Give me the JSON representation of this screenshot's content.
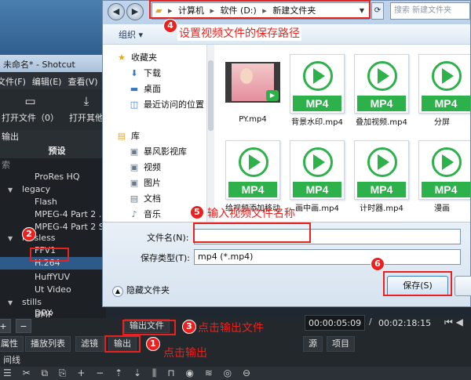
{
  "shotcut": {
    "title": "未命名* - Shotcut",
    "menu": [
      "文件(F)",
      "编辑(E)",
      "查看(V)"
    ],
    "toolbar": {
      "open_file": "打开文件（0）",
      "open_other": "打开其他"
    },
    "panel": {
      "output_tab": "输出",
      "presets_header": "预设",
      "search_hint": "索",
      "tree": [
        {
          "label": "ProRes HQ",
          "level": 2
        },
        {
          "label": "legacy",
          "level": 1,
          "expanded": true
        },
        {
          "label": "Flash",
          "level": 2
        },
        {
          "label": "MPEG-4 Part 2 ...",
          "level": 2
        },
        {
          "label": "MPEG-4 Part 2 S",
          "level": 2
        },
        {
          "label": "lossless",
          "level": 1,
          "expanded": true
        },
        {
          "label": "FFV1",
          "level": 2
        },
        {
          "label": "H.264",
          "level": 2,
          "selected": true
        },
        {
          "label": "HuffYUV",
          "level": 2
        },
        {
          "label": "Ut Video",
          "level": 2
        },
        {
          "label": "stills",
          "level": 1,
          "expanded": true
        },
        {
          "label": "BMP",
          "level": 2
        },
        {
          "label": "DPX",
          "level": 2
        }
      ]
    },
    "bottom": {
      "add": "+",
      "remove": "−",
      "export_file": "输出文件",
      "time_current": "00:00:05:09",
      "time_sep": "/",
      "time_total": "00:02:18:15"
    },
    "tabs": {
      "properties": "属性",
      "playlist": "播放列表",
      "filters": "滤镜",
      "export": "输出",
      "source": "源",
      "project": "项目"
    },
    "timeline_label": "间线"
  },
  "dialog": {
    "breadcrumb": [
      "计算机",
      "软件 (D:)",
      "新建文件夹"
    ],
    "search_placeholder": "搜索 新建文件夹",
    "organize": "组织 ▾",
    "nav": [
      {
        "label": "收藏夹",
        "icon": "star-icon"
      },
      {
        "label": "下载",
        "icon": "download-icon"
      },
      {
        "label": "桌面",
        "icon": "desktop-icon"
      },
      {
        "label": "最近访问的位置",
        "icon": "recent-icon"
      },
      {
        "label": "库",
        "icon": "library-icon"
      },
      {
        "label": "暴风影视库",
        "icon": "video-library-icon"
      },
      {
        "label": "视频",
        "icon": "video-icon"
      },
      {
        "label": "图片",
        "icon": "picture-icon"
      },
      {
        "label": "文档",
        "icon": "document-icon"
      },
      {
        "label": "音乐",
        "icon": "music-icon"
      }
    ],
    "files": [
      {
        "name": "PY.mp4",
        "kind": "video"
      },
      {
        "name": "背景水印.mp4",
        "kind": "mp4"
      },
      {
        "name": "叠加视频.mp4",
        "kind": "mp4"
      },
      {
        "name": "分屏",
        "kind": "mp4"
      },
      {
        "name": "给视频添加移动",
        "kind": "mp4"
      },
      {
        "name": "画中画.mp4",
        "kind": "mp4"
      },
      {
        "name": "计时器.mp4",
        "kind": "mp4"
      },
      {
        "name": "漫画",
        "kind": "mp4"
      }
    ],
    "mp4_label": "MP4",
    "filename_label": "文件名(N):",
    "filename_value": "",
    "filetype_label": "保存类型(T):",
    "filetype_value": "mp4 (*.mp4)",
    "hide_folders": "隐藏文件夹",
    "save": "保存(S)"
  },
  "annotations": {
    "step1": {
      "num": "1",
      "text": "点击输出"
    },
    "step2": {
      "num": "2"
    },
    "step3": {
      "num": "3",
      "text": "点击输出文件"
    },
    "step4": {
      "num": "4",
      "text": "设置视频文件的保存路径"
    },
    "step5": {
      "num": "5",
      "text": "输入视频文件名称"
    },
    "step6": {
      "num": "6"
    },
    "color": "#e8231f"
  }
}
